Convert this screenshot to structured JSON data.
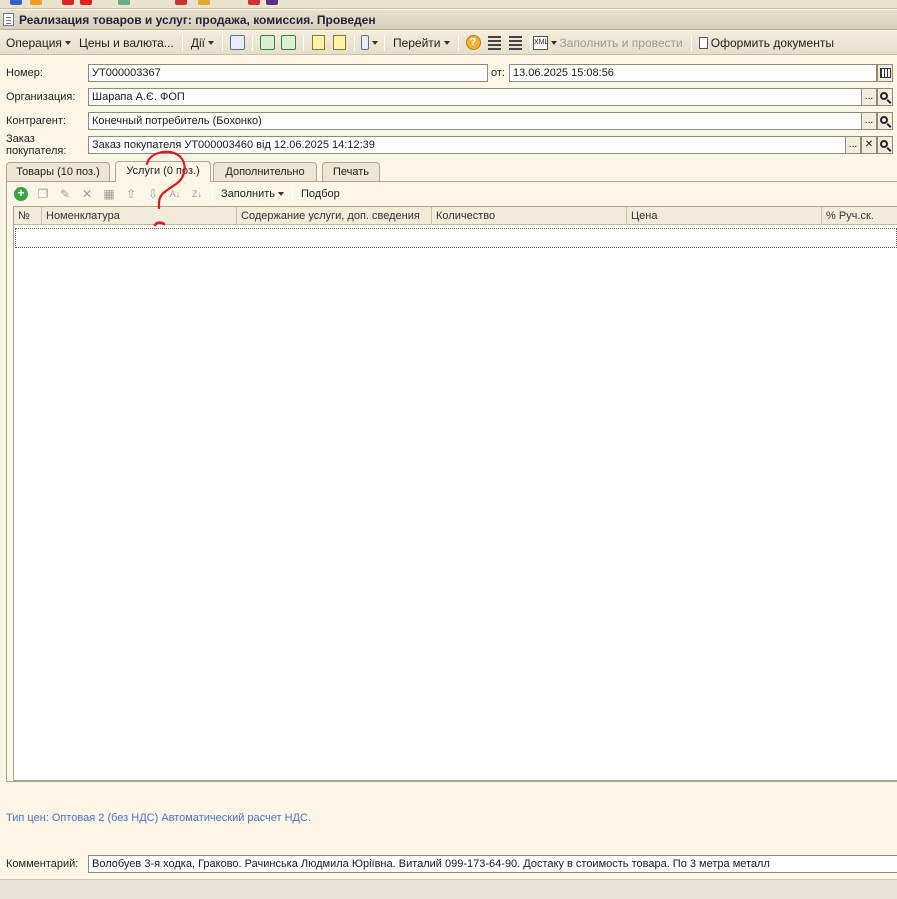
{
  "window": {
    "title": "Реализация товаров и услуг: продажа, комиссия. Проведен"
  },
  "toolbar": {
    "operation": "Операция",
    "prices": "Цены и валюта...",
    "actions": "Дії",
    "goto": "Перейти",
    "fill_post": "Заполнить и провести",
    "make_docs": "Оформить документы"
  },
  "form": {
    "number_label": "Номер:",
    "number_value": "УТ000003367",
    "date_label": "от:",
    "date_value": "13.06.2025 15:08:56",
    "org_label": "Организация:",
    "org_value": "Шарапа А.Є. ФОП",
    "contractor_label": "Контрагент:",
    "contractor_value": "Конечный потребитель (Бохонко)",
    "order_label": "Заказ покупателя:",
    "order_value": "Заказ покупателя УТ000003460 від 12.06.2025 14:12:39"
  },
  "tabs": [
    {
      "label": "Товары (10 поз.)"
    },
    {
      "label": "Услуги (0 поз.)"
    },
    {
      "label": "Дополнительно"
    },
    {
      "label": "Печать"
    }
  ],
  "subtoolbar": {
    "fill": "Заполнить",
    "pick": "Подбор"
  },
  "table": {
    "columns": [
      "№",
      "Номенклатура",
      "Содержание услуги, доп. сведения",
      "Количество",
      "Цена",
      "% Руч.ск."
    ],
    "rows": []
  },
  "price_info": "Тип цен: Оптовая 2 (без НДС) Автоматический расчет НДС.",
  "comment": {
    "label": "Комментарий:",
    "value": "Волобуев 3-я ходка, Граково.  Рачинська Людмила Юріївна.   Виталий 099-173-64-90. Достаку в стоимость товара. По 3 метра металл"
  },
  "annotation": {
    "color": "#e01818",
    "shape": "question-mark"
  }
}
